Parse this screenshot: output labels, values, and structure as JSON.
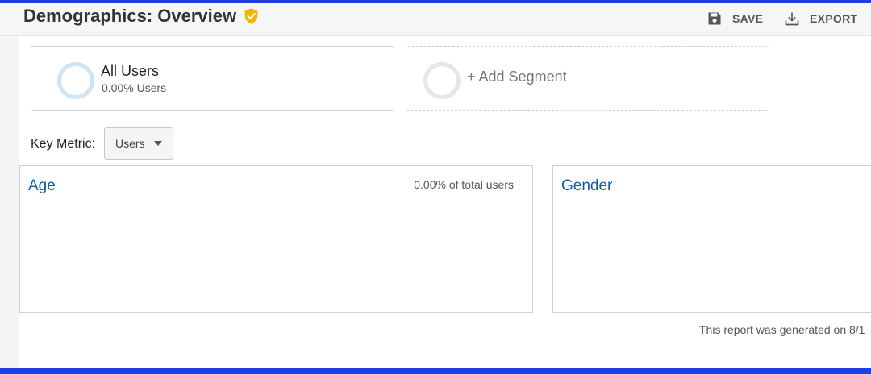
{
  "header": {
    "title": "Demographics: Overview",
    "verified_icon": "shield-check-icon",
    "save_label": "SAVE",
    "export_label": "EXPORT"
  },
  "segments": {
    "active": {
      "name": "All Users",
      "share": "0.00% Users"
    },
    "add_label": "+ Add Segment"
  },
  "key_metric": {
    "label": "Key Metric:",
    "value": "Users"
  },
  "panels": {
    "age": {
      "title": "Age",
      "stat": "0.00% of total users"
    },
    "gender": {
      "title": "Gender"
    }
  },
  "footer": {
    "note": "This report was generated on 8/1"
  },
  "colors": {
    "accent_link": "#0d5ea8",
    "frame_border": "#1f3fe6",
    "verified_badge": "#f4b400"
  }
}
